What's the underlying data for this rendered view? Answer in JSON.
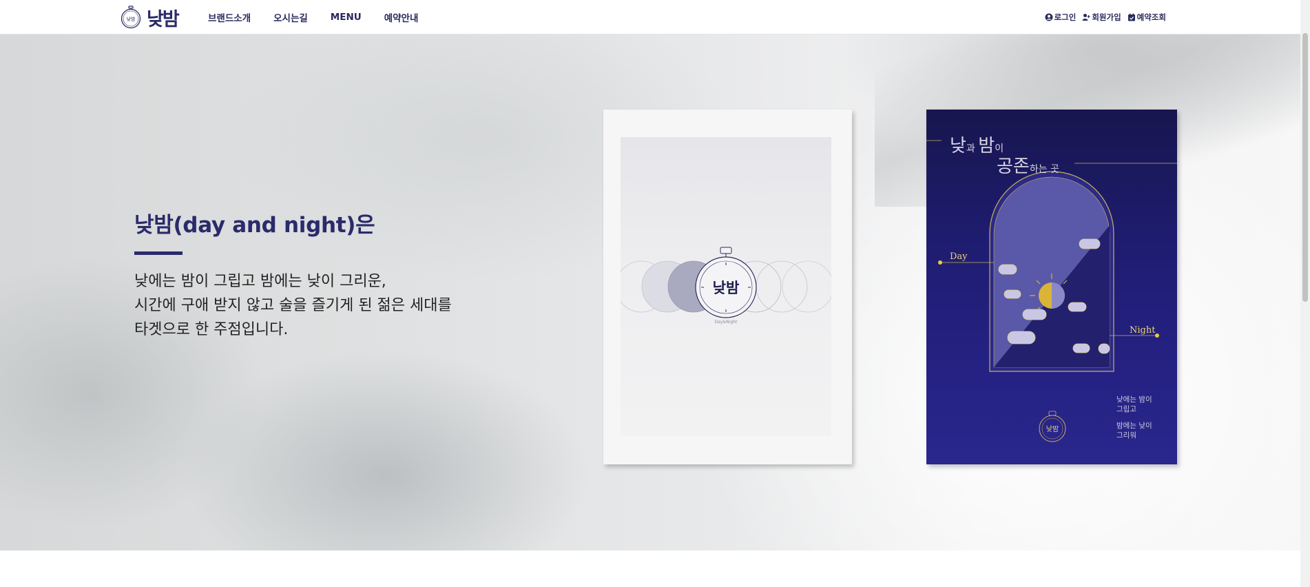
{
  "header": {
    "logo_text": "낮밤",
    "nav": [
      "브랜드소개",
      "오시는길",
      "MENU",
      "예약안내"
    ],
    "util": [
      {
        "icon": "user-circle-icon",
        "label": "로그인"
      },
      {
        "icon": "user-plus-icon",
        "label": "회원가입"
      },
      {
        "icon": "calendar-check-icon",
        "label": "예약조회"
      }
    ]
  },
  "hero": {
    "title": "낮밤(day and night)은",
    "desc": [
      "낮에는 밤이 그립고 밤에는 낮이 그리운,",
      "시간에 구애 받지 않고 술을 즐기게 된 젊은 세대를",
      "타겟으로 한 주점입니다."
    ]
  },
  "poster_light": {
    "logo_text": "낮밤",
    "caption": "Day&Night"
  },
  "poster_dark": {
    "title_line1_big1": "낮",
    "title_line1_small1": "과 ",
    "title_line1_big2": "밤",
    "title_line1_small2": "이",
    "title_line2_big": "공존",
    "title_line2_small": "하는 곳",
    "label_day": "Day",
    "label_night": "Night",
    "sub1": [
      "낮에는 밤이",
      "그립고"
    ],
    "sub2": [
      "밤에는 낮이",
      "그리워"
    ],
    "logo_text": "낮밤"
  },
  "colors": {
    "brand_navy": "#2b2a6b",
    "poster_navy": "#1f1d72",
    "gold": "#e8c94a"
  }
}
